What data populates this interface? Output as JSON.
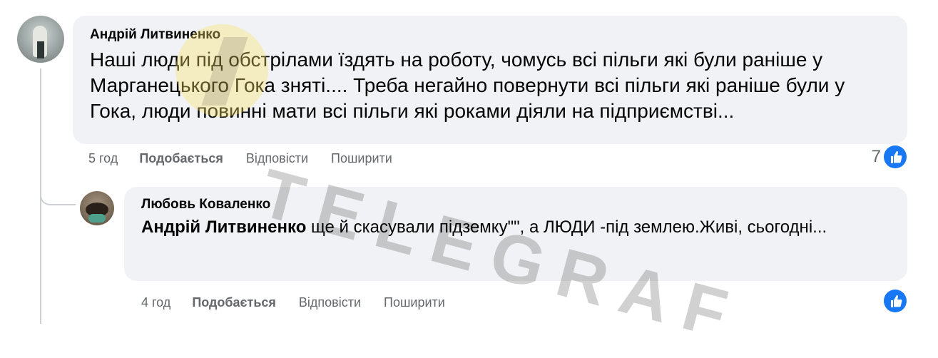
{
  "comments": [
    {
      "author": "Андрій Литвиненко",
      "text": "Наші люди під обстрілами їздять на роботу, чомусь всі пільги які були раніше у Марганецького Гока зняті.... Треба негайно повернути всі пільги які раніше були у Гока, люди повинні мати всі пільги які роками діяли на підприємстві...",
      "time": "5 год",
      "like_label": "Подобається",
      "reply_label": "Відповісти",
      "share_label": "Поширити",
      "reaction_count": "7"
    },
    {
      "author": "Любовь Коваленко",
      "mention": "Андрій Литвиненко",
      "text": " ще й скасували підземку\"\", а ЛЮДИ -під землею.Живі, сьогодні...",
      "time": "4 год",
      "like_label": "Подобається",
      "reply_label": "Відповісти",
      "share_label": "Поширити",
      "reaction_count": ""
    }
  ],
  "watermark": "TELEGRAF",
  "colors": {
    "bubble": "#f0f2f5",
    "meta_text": "#65676b",
    "like_blue": "#1877f2"
  },
  "icons": {
    "like": "thumbs-up-icon"
  }
}
